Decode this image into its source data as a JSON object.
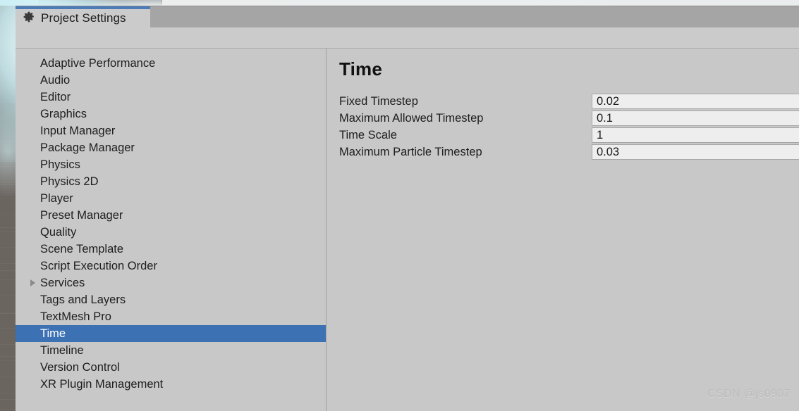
{
  "window": {
    "tab": {
      "label": "Project Settings",
      "icon": "gear-icon",
      "accent_color": "#4b7cb8"
    }
  },
  "sidebar": {
    "selected": "Time",
    "selection_color": "#3c72b3",
    "items": [
      {
        "label": "Adaptive Performance",
        "expandable": false,
        "selected": false
      },
      {
        "label": "Audio",
        "expandable": false,
        "selected": false
      },
      {
        "label": "Editor",
        "expandable": false,
        "selected": false
      },
      {
        "label": "Graphics",
        "expandable": false,
        "selected": false
      },
      {
        "label": "Input Manager",
        "expandable": false,
        "selected": false
      },
      {
        "label": "Package Manager",
        "expandable": false,
        "selected": false
      },
      {
        "label": "Physics",
        "expandable": false,
        "selected": false
      },
      {
        "label": "Physics 2D",
        "expandable": false,
        "selected": false
      },
      {
        "label": "Player",
        "expandable": false,
        "selected": false
      },
      {
        "label": "Preset Manager",
        "expandable": false,
        "selected": false
      },
      {
        "label": "Quality",
        "expandable": false,
        "selected": false
      },
      {
        "label": "Scene Template",
        "expandable": false,
        "selected": false
      },
      {
        "label": "Script Execution Order",
        "expandable": false,
        "selected": false
      },
      {
        "label": "Services",
        "expandable": true,
        "selected": false
      },
      {
        "label": "Tags and Layers",
        "expandable": false,
        "selected": false
      },
      {
        "label": "TextMesh Pro",
        "expandable": false,
        "selected": false
      },
      {
        "label": "Time",
        "expandable": false,
        "selected": true
      },
      {
        "label": "Timeline",
        "expandable": false,
        "selected": false
      },
      {
        "label": "Version Control",
        "expandable": false,
        "selected": false
      },
      {
        "label": "XR Plugin Management",
        "expandable": false,
        "selected": false
      }
    ]
  },
  "main": {
    "title": "Time",
    "fields": [
      {
        "label": "Fixed Timestep",
        "value": "0.02"
      },
      {
        "label": "Maximum Allowed Timestep",
        "value": "0.1"
      },
      {
        "label": "Time Scale",
        "value": "1"
      },
      {
        "label": "Maximum Particle Timestep",
        "value": "0.03"
      }
    ]
  },
  "watermark": {
    "text": "CSDN @js0907"
  }
}
